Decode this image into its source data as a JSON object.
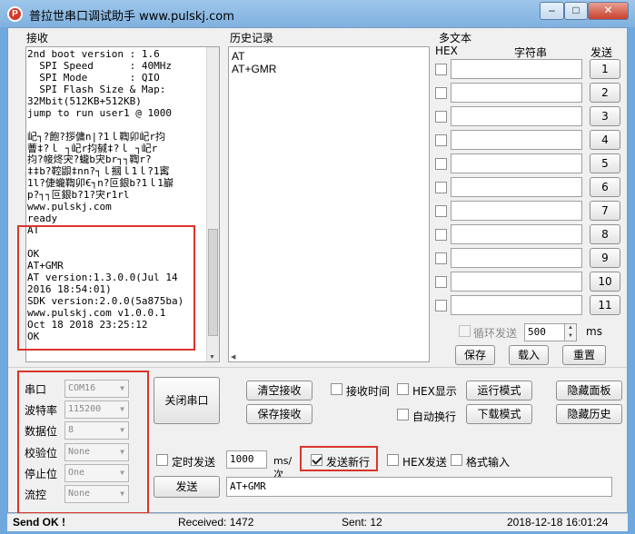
{
  "window": {
    "icon_glyph": "P",
    "title": "普拉世串口调试助手 www.pulskj.com",
    "minimize": "–",
    "maximize": "□",
    "close": "✕"
  },
  "receive": {
    "label": "接收",
    "lines": [
      "2nd boot version : 1.6",
      "  SPI Speed      : 40MHz",
      "  SPI Mode       : QIO",
      "  SPI Flash Size & Map:",
      "32Mbit(512KB+512KB)",
      "jump to run user1 @ 1000",
      "",
      "屺┐?飽?拶傭n|?1ｌ鞫卯屺r抣",
      "蓸‡?ｌ ┐屺r抣戫‡?ｌ ┐屺r",
      "抣?帹炵宊?蠬b宊br┐┐鞫r?",
      "‡‡b?鞚鼰‡nn?┐ｌ摑ｌ1ｌ?1寗",
      "1l?倢蠬鞫卯€┐n?叵銀b?1ｌ1巐",
      "p?┐┐叵銀b?1?宊r1rl",
      "www.pulskj.com",
      "ready",
      "AT",
      "",
      "OK",
      "AT+GMR",
      "AT version:1.3.0.0(Jul 14",
      "2016 18:54:01)",
      "SDK version:2.0.0(5a875ba)",
      "www.pulskj.com v1.0.0.1",
      "Oct 18 2018 23:25:12",
      "OK"
    ]
  },
  "history": {
    "label": "历史记录",
    "items": [
      "AT",
      "AT+GMR"
    ]
  },
  "multi": {
    "label": "多文本",
    "hex_header": "HEX",
    "string_header": "字符串",
    "send_header": "发送",
    "rows": [
      "1",
      "2",
      "3",
      "4",
      "5",
      "6",
      "7",
      "8",
      "9",
      "10",
      "11"
    ],
    "loop_label": "循环发送",
    "loop_value": "500",
    "loop_unit": "ms",
    "save": "保存",
    "load": "载入",
    "reset": "重置"
  },
  "serial": {
    "port_label": "串口",
    "port_value": "COM16",
    "baud_label": "波特率",
    "baud_value": "115200",
    "data_label": "数据位",
    "data_value": "8",
    "parity_label": "校验位",
    "parity_value": "None",
    "stop_label": "停止位",
    "stop_value": "One",
    "flow_label": "流控",
    "flow_value": "None"
  },
  "controls": {
    "close_port": "关闭串口",
    "clear_recv": "清空接收",
    "save_recv": "保存接收",
    "recv_time": "接收时间",
    "hex_display": "HEX显示",
    "auto_wrap": "自动换行",
    "run_mode": "运行模式",
    "download_mode": "下载模式",
    "hide_panel": "隐藏面板",
    "hide_history": "隐藏历史",
    "timed_send": "定时发送",
    "timed_value": "1000",
    "timed_unit": "ms/次",
    "send_newline": "发送新行",
    "hex_send": "HEX发送",
    "format_input": "格式输入",
    "send": "发送",
    "send_text": "AT+GMR"
  },
  "status": {
    "send_ok": "Send OK !",
    "received": "Received: 1472",
    "sent": "Sent: 12",
    "datetime": "2018-12-18 16:01:24"
  }
}
